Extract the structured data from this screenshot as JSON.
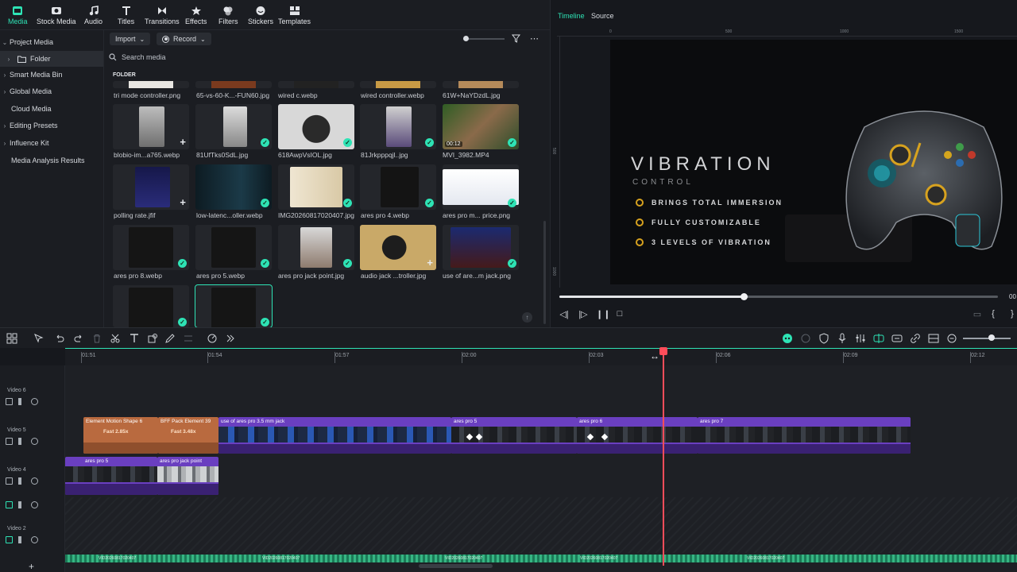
{
  "toolbar": {
    "items": [
      {
        "label": "Media",
        "icon": "media-icon"
      },
      {
        "label": "Stock Media",
        "icon": "stock-media-icon"
      },
      {
        "label": "Audio",
        "icon": "music-note-icon"
      },
      {
        "label": "Titles",
        "icon": "titles-icon"
      },
      {
        "label": "Transitions",
        "icon": "transitions-icon"
      },
      {
        "label": "Effects",
        "icon": "effects-icon"
      },
      {
        "label": "Filters",
        "icon": "filters-icon"
      },
      {
        "label": "Stickers",
        "icon": "stickers-icon"
      },
      {
        "label": "Templates",
        "icon": "templates-icon"
      }
    ],
    "active": "Media",
    "accent": "#2ee3b5"
  },
  "leftnav": {
    "project_media": "Project Media",
    "folder": "Folder",
    "smart_media_bin": "Smart Media Bin",
    "global_media": "Global Media",
    "cloud_media": "Cloud Media",
    "editing_presets": "Editing Presets",
    "influence_kit": "Influence Kit",
    "media_analysis": "Media Analysis Results"
  },
  "media": {
    "import_label": "Import",
    "record_label": "Record",
    "search_placeholder": "Search media",
    "folder_heading": "FOLDER",
    "row0_captions": [
      "tri mode controller.png",
      "65-vs-60-K...-FUN60.jpg",
      "wired c.webp",
      "wired controller.webp",
      "61W+NaYDzdL.jpg"
    ],
    "row1_captions": [
      "blobio-im...a765.webp",
      "81UfTks0SdL.jpg",
      "618AwpVsIOL.jpg",
      "81Jrkpppqjl..jpg",
      "MVI_3982.MP4"
    ],
    "row2_captions": [
      "polling rate.jfif",
      "low-latenc...oller.webp",
      "IMG20260817020407.jpg",
      "ares pro 4.webp",
      "ares pro m... price.png"
    ],
    "row3_captions": [
      "ares pro 8.webp",
      "ares pro 5.webp",
      "ares pro jack point.jpg",
      "audio jack ...troller.jpg",
      "use of are...m jack.png"
    ],
    "video_duration": "00:12",
    "check_glyph": "✓",
    "plus_glyph": "+"
  },
  "preview": {
    "tab_timeline": "Timeline",
    "tab_source": "Source",
    "ruler_labels": [
      "0",
      "500",
      "1000",
      "1500"
    ],
    "vertical_ruler_labels": [
      "500",
      "1000"
    ],
    "title": "VIBRATION",
    "subtitle": "CONTROL",
    "features": [
      "BRINGS TOTAL IMMERSION",
      "FULLY CUSTOMIZABLE",
      "3 LEVELS OF VIBRATION"
    ],
    "progress": 0.42,
    "time_readout": "00"
  },
  "timeline": {
    "ruler_labels": [
      "01:51",
      "01:54",
      "01:57",
      "02:00",
      "02:03",
      "02:06",
      "02:09",
      "02:12"
    ],
    "tracks": [
      "Video 6",
      "Video 5",
      "Video 4",
      "Video 2"
    ],
    "clips_v5": [
      {
        "title": "Element Motion Shape 6",
        "speed": "Fast 2.85x"
      },
      {
        "title": "BFF Pack Element 39",
        "speed": "Fast 3.48x"
      },
      {
        "title": "use of ares pro 3.5 mm jack"
      },
      {
        "title": "ares pro 5"
      },
      {
        "title": "ares pro 6"
      },
      {
        "title": "ares pro 7"
      }
    ],
    "clips_v4": [
      {
        "title": "ares pro 5"
      },
      {
        "title": "ares pro jack point"
      }
    ],
    "audio_label": "VID20260817020407",
    "add_track": "+"
  }
}
